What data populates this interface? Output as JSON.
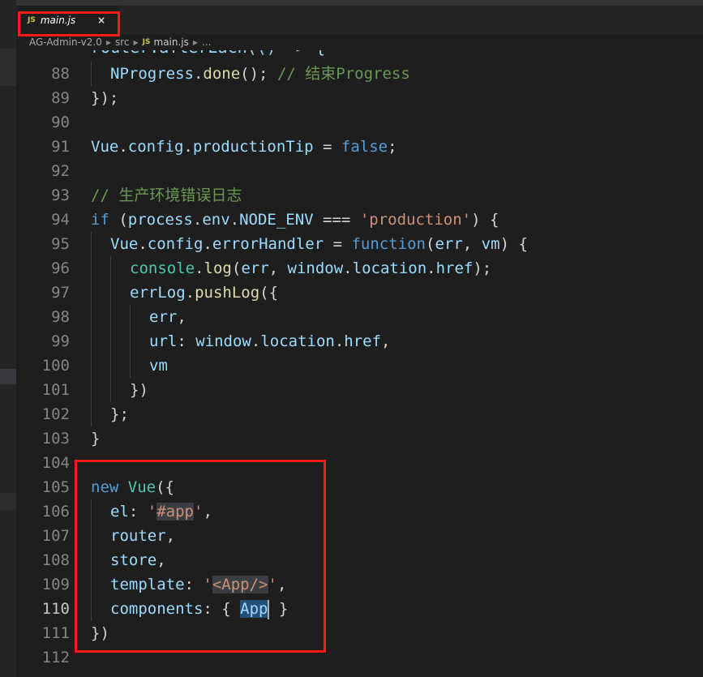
{
  "tab": {
    "icon_text": "JS",
    "title": "main.js",
    "close": "×"
  },
  "breadcrumb": {
    "project": "AG-Admin-v2.0",
    "folder": "src",
    "icon_text": "JS",
    "file": "main.js",
    "more": "..."
  },
  "partial_line": "router.afterEach(() => {",
  "active_line": "110",
  "lines": [
    {
      "n": "88",
      "indent": 1,
      "tokens": [
        [
          "NProgress",
          "v"
        ],
        [
          ".",
          "p"
        ],
        [
          "done",
          "f"
        ],
        [
          "(); ",
          "p"
        ],
        [
          "// 结束Progress",
          "c"
        ]
      ]
    },
    {
      "n": "89",
      "indent": 0,
      "tokens": [
        [
          "});",
          "p"
        ]
      ]
    },
    {
      "n": "90",
      "indent": 0,
      "tokens": []
    },
    {
      "n": "91",
      "indent": 0,
      "tokens": [
        [
          "Vue",
          "v"
        ],
        [
          ".",
          "p"
        ],
        [
          "config",
          "v"
        ],
        [
          ".",
          "p"
        ],
        [
          "productionTip",
          "v"
        ],
        [
          " = ",
          "p"
        ],
        [
          "false",
          "k"
        ],
        [
          ";",
          "p"
        ]
      ]
    },
    {
      "n": "92",
      "indent": 0,
      "tokens": []
    },
    {
      "n": "93",
      "indent": 0,
      "tokens": [
        [
          "// 生产环境错误日志",
          "c"
        ]
      ]
    },
    {
      "n": "94",
      "indent": 0,
      "tokens": [
        [
          "if",
          "k"
        ],
        [
          " (",
          "p"
        ],
        [
          "process",
          "v"
        ],
        [
          ".",
          "p"
        ],
        [
          "env",
          "v"
        ],
        [
          ".",
          "p"
        ],
        [
          "NODE_ENV",
          "v"
        ],
        [
          " === ",
          "p"
        ],
        [
          "'production'",
          "s"
        ],
        [
          ") {",
          "p"
        ]
      ]
    },
    {
      "n": "95",
      "indent": 1,
      "tokens": [
        [
          "Vue",
          "v"
        ],
        [
          ".",
          "p"
        ],
        [
          "config",
          "v"
        ],
        [
          ".",
          "p"
        ],
        [
          "errorHandler",
          "v"
        ],
        [
          " = ",
          "p"
        ],
        [
          "function",
          "k"
        ],
        [
          "(",
          "p"
        ],
        [
          "err",
          "v"
        ],
        [
          ", ",
          "p"
        ],
        [
          "vm",
          "v"
        ],
        [
          ") {",
          "p"
        ]
      ]
    },
    {
      "n": "96",
      "indent": 2,
      "tokens": [
        [
          "console",
          "t"
        ],
        [
          ".",
          "p"
        ],
        [
          "log",
          "f"
        ],
        [
          "(",
          "p"
        ],
        [
          "err",
          "v"
        ],
        [
          ", ",
          "p"
        ],
        [
          "window",
          "v"
        ],
        [
          ".",
          "p"
        ],
        [
          "location",
          "v"
        ],
        [
          ".",
          "p"
        ],
        [
          "href",
          "v"
        ],
        [
          ");",
          "p"
        ]
      ]
    },
    {
      "n": "97",
      "indent": 2,
      "tokens": [
        [
          "errLog",
          "v"
        ],
        [
          ".",
          "p"
        ],
        [
          "pushLog",
          "f"
        ],
        [
          "({",
          "p"
        ]
      ]
    },
    {
      "n": "98",
      "indent": 3,
      "tokens": [
        [
          "err",
          "v"
        ],
        [
          ",",
          "p"
        ]
      ]
    },
    {
      "n": "99",
      "indent": 3,
      "tokens": [
        [
          "url",
          "v"
        ],
        [
          ": ",
          "p"
        ],
        [
          "window",
          "v"
        ],
        [
          ".",
          "p"
        ],
        [
          "location",
          "v"
        ],
        [
          ".",
          "p"
        ],
        [
          "href",
          "v"
        ],
        [
          ",",
          "p"
        ]
      ]
    },
    {
      "n": "100",
      "indent": 3,
      "tokens": [
        [
          "vm",
          "v"
        ]
      ]
    },
    {
      "n": "101",
      "indent": 2,
      "tokens": [
        [
          "})",
          "p"
        ]
      ]
    },
    {
      "n": "102",
      "indent": 1,
      "tokens": [
        [
          "};",
          "p"
        ]
      ]
    },
    {
      "n": "103",
      "indent": 0,
      "tokens": [
        [
          "}",
          "p"
        ]
      ]
    },
    {
      "n": "104",
      "indent": 0,
      "tokens": []
    },
    {
      "n": "105",
      "indent": 0,
      "tokens": [
        [
          "new",
          "k"
        ],
        [
          " ",
          "p"
        ],
        [
          "Vue",
          "t"
        ],
        [
          "({",
          "p"
        ]
      ]
    },
    {
      "n": "106",
      "indent": 1,
      "tokens": [
        [
          "el",
          "v"
        ],
        [
          ": ",
          "p"
        ],
        [
          "'",
          "s"
        ],
        [
          "#app",
          "s hl"
        ],
        [
          "'",
          "s"
        ],
        [
          ",",
          "p"
        ]
      ]
    },
    {
      "n": "107",
      "indent": 1,
      "tokens": [
        [
          "router",
          "v"
        ],
        [
          ",",
          "p"
        ]
      ]
    },
    {
      "n": "108",
      "indent": 1,
      "tokens": [
        [
          "store",
          "v"
        ],
        [
          ",",
          "p"
        ]
      ]
    },
    {
      "n": "109",
      "indent": 1,
      "tokens": [
        [
          "template",
          "v"
        ],
        [
          ": ",
          "p"
        ],
        [
          "'",
          "s"
        ],
        [
          "<App/>",
          "s hl"
        ],
        [
          "'",
          "s"
        ],
        [
          ",",
          "p"
        ]
      ]
    },
    {
      "n": "110",
      "indent": 1,
      "tokens": [
        [
          "components",
          "v"
        ],
        [
          ": { ",
          "p"
        ],
        [
          "App",
          "sel"
        ],
        [
          "|cursor|",
          "cursor"
        ],
        [
          " }",
          "p"
        ]
      ]
    },
    {
      "n": "111",
      "indent": 0,
      "tokens": [
        [
          "})",
          "p"
        ]
      ]
    },
    {
      "n": "112",
      "indent": 0,
      "tokens": []
    }
  ],
  "colors": {
    "keyword": "#569cd6",
    "variable": "#9cdcfe",
    "function": "#dcdcaa",
    "type": "#4ec9b0",
    "string": "#ce9178",
    "comment": "#6a9955",
    "annotation_box": "#ff1a1a",
    "background": "#1e1e1e"
  }
}
